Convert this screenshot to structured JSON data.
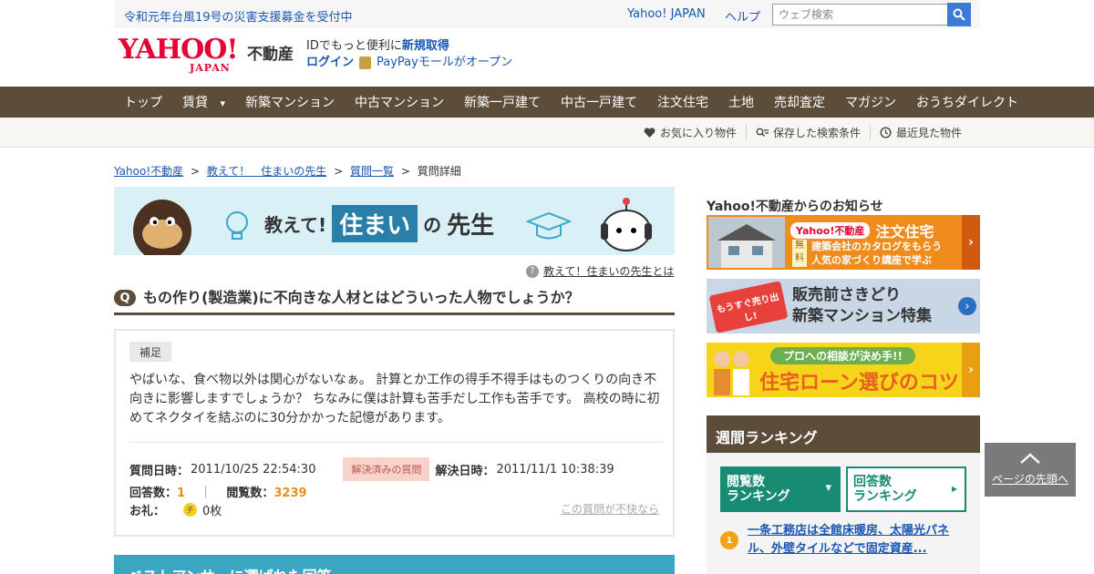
{
  "topbar": {
    "notice": "令和元年台風19号の災害支援募金を受付中",
    "yahoo_japan": "Yahoo! JAPAN",
    "help": "ヘルプ",
    "search_placeholder": "ウェブ検索"
  },
  "logo": {
    "main": "YAHOO!",
    "sub": "JAPAN",
    "category": "不動産"
  },
  "login": {
    "id_text": "IDでもっと便利に",
    "signup": "新規取得",
    "login": "ログイン",
    "paypay": "PayPayモールがオープン"
  },
  "mainnav": [
    "トップ",
    "賃貸",
    "新築マンション",
    "中古マンション",
    "新築一戸建て",
    "中古一戸建て",
    "注文住宅",
    "土地",
    "売却査定",
    "マガジン",
    "おうちダイレクト"
  ],
  "subnav": {
    "favorites": "お気に入り物件",
    "saved_search": "保存した検索条件",
    "recent": "最近見た物件"
  },
  "breadcrumb": {
    "items": [
      "Yahoo!不動産",
      "教えて！　住まいの先生",
      "質問一覧"
    ],
    "current": "質問詳細",
    "sep": ">"
  },
  "banner": {
    "prefix": "教えて!",
    "sumai": "住まい",
    "no": "の",
    "sensei": "先生"
  },
  "about": {
    "icon": "?",
    "text": "教えて！住まいの先生とは"
  },
  "question": {
    "badge": "Q",
    "title": "もの作り(製造業)に不向きな人材とはどういった人物でしょうか？",
    "supplement_label": "補足",
    "body": "やばいな、食べ物以外は関心がないなぁ。 計算とか工作の得手不得手はものつくりの向き不向きに影響しますでしょうか？ ちなみに僕は計算も苦手だし工作も苦手です。 高校の時に初めてネクタイを結ぶのに30分かかった記憶があります。",
    "asked_label": "質問日時：",
    "asked_at": "2011/10/25 22:54:30",
    "resolved_badge": "解決済みの質問",
    "resolved_label": "解決日時：",
    "resolved_at": "2011/11/1 10:38:39",
    "answers_label": "回答数：",
    "answers": "1",
    "views_label": "閲覧数：",
    "views": "3239",
    "divider": "｜",
    "thanks_label": "お礼：",
    "chip_icon": "チ",
    "thanks": "0枚",
    "report": "この質問が不快なら"
  },
  "best_answer": {
    "title": "ベストアンサーに選ばれた回答"
  },
  "sidebar": {
    "info_title": "Yahoo!不動産からのお知らせ",
    "promo1": {
      "brand": "Yahoo!不動産",
      "title": "注文住宅",
      "free": "無料",
      "line1": "建築会社のカタログをもらう",
      "line2": "人気の家づくり講座で学ぶ"
    },
    "promo2": {
      "tag": "もうすぐ売り出し!",
      "line1": "販売前さきどり",
      "line2": "新築マンション特集"
    },
    "promo3": {
      "tag": "プロへの相談が決め手!!",
      "title": "住宅ローン選びのコツ"
    },
    "ranking_title": "週間ランキング",
    "tab_views_1": "閲覧数",
    "tab_views_2": "ランキング",
    "tab_answers_1": "回答数",
    "tab_answers_2": "ランキング",
    "rank1_num": "1",
    "rank1_text": "一条工務店は全館床暖房、太陽光パネル、外壁タイルなどで固定資産..."
  },
  "to_top": "ページの先頭へ",
  "colors": {
    "nav_brown": "#5b4d3a",
    "link_blue": "#1a57b3",
    "yahoo_red": "#e60033",
    "rank_green": "#188c73",
    "best_answer_teal": "#3aa6c2"
  }
}
